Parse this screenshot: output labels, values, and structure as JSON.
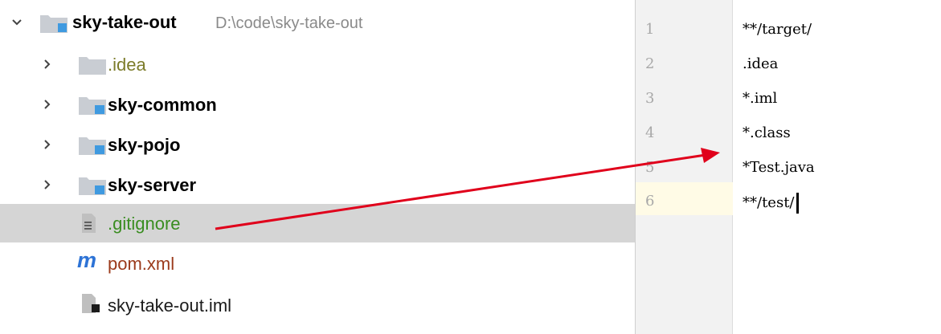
{
  "tree": {
    "root": {
      "name": "sky-take-out",
      "path": "D:\\code\\sky-take-out"
    },
    "items": [
      {
        "name": ".idea"
      },
      {
        "name": "sky-common"
      },
      {
        "name": "sky-pojo"
      },
      {
        "name": "sky-server"
      },
      {
        "name": ".gitignore"
      },
      {
        "name": "pom.xml"
      },
      {
        "name": "sky-take-out.iml"
      }
    ]
  },
  "editor": {
    "lines": [
      {
        "num": "1",
        "text": "**/target/"
      },
      {
        "num": "2",
        "text": ".idea"
      },
      {
        "num": "3",
        "text": "*.iml"
      },
      {
        "num": "4",
        "text": "*.class"
      },
      {
        "num": "5",
        "text": "*Test.java"
      },
      {
        "num": "6",
        "text": "**/test/"
      }
    ]
  },
  "colors": {
    "selection": "#d5d5d5",
    "arrow": "#e0001b",
    "current_line": "#fffbe6",
    "folder": "#c9cdd3",
    "module_badge": "#3f9ae0"
  }
}
